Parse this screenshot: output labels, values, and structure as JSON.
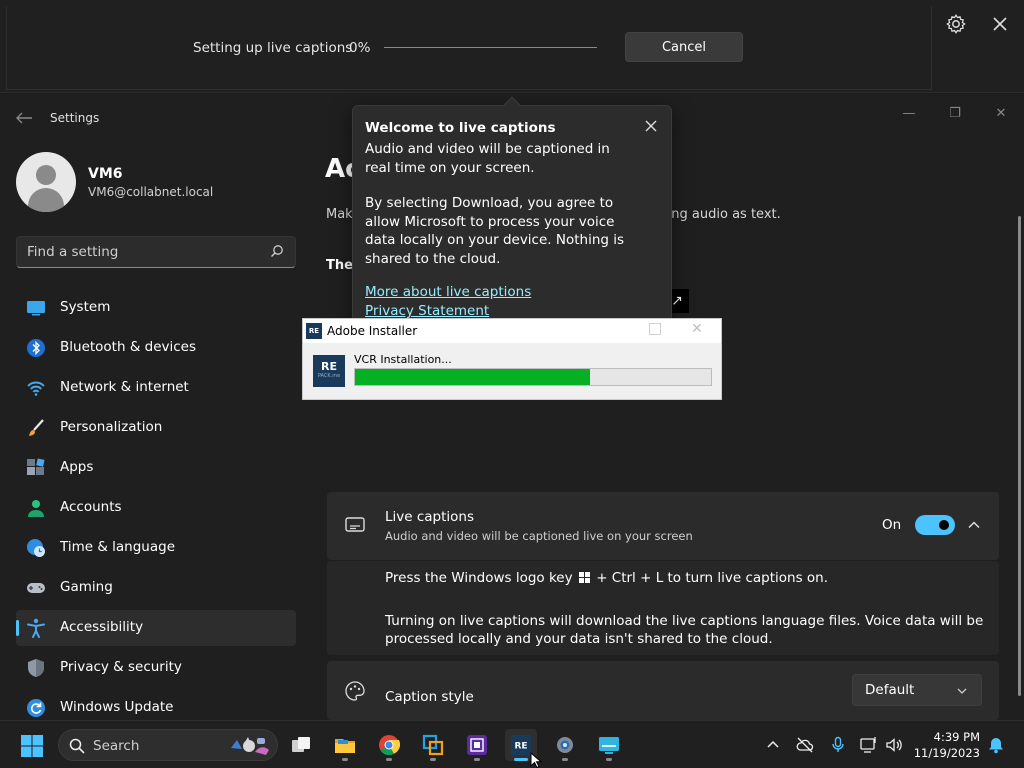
{
  "live_captions_bar": {
    "status": "Setting up live captions",
    "percent": "0%",
    "progress_fraction": 0,
    "cancel_label": "Cancel"
  },
  "settings": {
    "window_title": "Settings",
    "user": {
      "name": "VM6",
      "email": "VM6@collabnet.local"
    },
    "search_placeholder": "Find a setting",
    "nav": [
      {
        "label": "System",
        "icon": "monitor-icon"
      },
      {
        "label": "Bluetooth & devices",
        "icon": "bluetooth-icon"
      },
      {
        "label": "Network & internet",
        "icon": "wifi-icon"
      },
      {
        "label": "Personalization",
        "icon": "brush-icon"
      },
      {
        "label": "Apps",
        "icon": "apps-icon"
      },
      {
        "label": "Accounts",
        "icon": "person-icon"
      },
      {
        "label": "Time & language",
        "icon": "clock-globe-icon"
      },
      {
        "label": "Gaming",
        "icon": "gamepad-icon"
      },
      {
        "label": "Accessibility",
        "icon": "accessibility-icon",
        "selected": true
      },
      {
        "label": "Privacy & security",
        "icon": "shield-icon"
      },
      {
        "label": "Windows Update",
        "icon": "refresh-icon"
      }
    ],
    "main": {
      "title_partial": "Ac",
      "desc_left": "Mak",
      "desc_right": "ying audio as text.",
      "theme_partial": "Ther",
      "live_captions": {
        "title": "Live captions",
        "subtitle": "Audio and video will be captioned live on your screen",
        "state_label": "On",
        "enabled": true,
        "hint_before": "Press the Windows logo key",
        "hint_after": "+ Ctrl + L to turn live captions on.",
        "download_note": "Turning on live captions will download the live captions language files. Voice data will be processed locally and your data isn't shared to the cloud."
      },
      "caption_style": {
        "title": "Caption style",
        "value": "Default"
      }
    }
  },
  "welcome_popup": {
    "title": "Welcome to live captions",
    "para1": "Audio and video will be captioned in real time on your screen.",
    "para2": "By selecting Download, you agree to allow Microsoft to process your voice data locally on your device. Nothing is shared to the cloud.",
    "link1": "More about live captions",
    "link2": "Privacy Statement"
  },
  "adobe_installer": {
    "title": "Adobe Installer",
    "logo_text": "RE",
    "logo_sub": "PACK.me",
    "step": "VCR Installation...",
    "progress_fraction": 0.66
  },
  "taskbar": {
    "search_label": "Search",
    "time": "4:39 PM",
    "date": "11/19/2023",
    "colors": {
      "accent": "#4cc2ff",
      "progress_green": "#06b025"
    }
  }
}
